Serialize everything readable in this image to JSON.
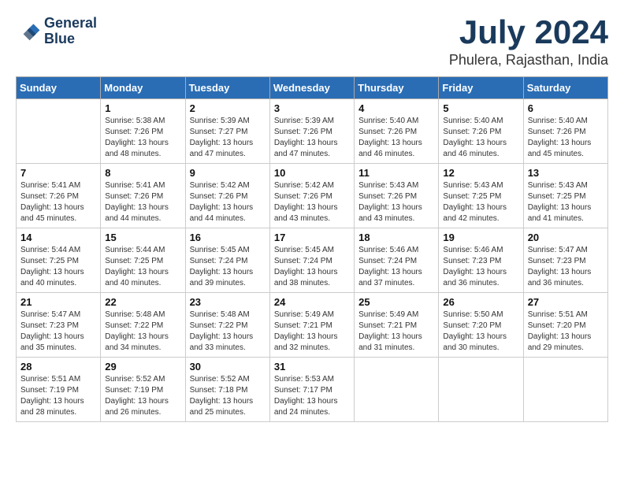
{
  "header": {
    "logo_line1": "General",
    "logo_line2": "Blue",
    "month_year": "July 2024",
    "location": "Phulera, Rajasthan, India"
  },
  "weekdays": [
    "Sunday",
    "Monday",
    "Tuesday",
    "Wednesday",
    "Thursday",
    "Friday",
    "Saturday"
  ],
  "weeks": [
    [
      {
        "day": "",
        "info": ""
      },
      {
        "day": "1",
        "info": "Sunrise: 5:38 AM\nSunset: 7:26 PM\nDaylight: 13 hours\nand 48 minutes."
      },
      {
        "day": "2",
        "info": "Sunrise: 5:39 AM\nSunset: 7:27 PM\nDaylight: 13 hours\nand 47 minutes."
      },
      {
        "day": "3",
        "info": "Sunrise: 5:39 AM\nSunset: 7:26 PM\nDaylight: 13 hours\nand 47 minutes."
      },
      {
        "day": "4",
        "info": "Sunrise: 5:40 AM\nSunset: 7:26 PM\nDaylight: 13 hours\nand 46 minutes."
      },
      {
        "day": "5",
        "info": "Sunrise: 5:40 AM\nSunset: 7:26 PM\nDaylight: 13 hours\nand 46 minutes."
      },
      {
        "day": "6",
        "info": "Sunrise: 5:40 AM\nSunset: 7:26 PM\nDaylight: 13 hours\nand 45 minutes."
      }
    ],
    [
      {
        "day": "7",
        "info": "Sunrise: 5:41 AM\nSunset: 7:26 PM\nDaylight: 13 hours\nand 45 minutes."
      },
      {
        "day": "8",
        "info": "Sunrise: 5:41 AM\nSunset: 7:26 PM\nDaylight: 13 hours\nand 44 minutes."
      },
      {
        "day": "9",
        "info": "Sunrise: 5:42 AM\nSunset: 7:26 PM\nDaylight: 13 hours\nand 44 minutes."
      },
      {
        "day": "10",
        "info": "Sunrise: 5:42 AM\nSunset: 7:26 PM\nDaylight: 13 hours\nand 43 minutes."
      },
      {
        "day": "11",
        "info": "Sunrise: 5:43 AM\nSunset: 7:26 PM\nDaylight: 13 hours\nand 43 minutes."
      },
      {
        "day": "12",
        "info": "Sunrise: 5:43 AM\nSunset: 7:25 PM\nDaylight: 13 hours\nand 42 minutes."
      },
      {
        "day": "13",
        "info": "Sunrise: 5:43 AM\nSunset: 7:25 PM\nDaylight: 13 hours\nand 41 minutes."
      }
    ],
    [
      {
        "day": "14",
        "info": "Sunrise: 5:44 AM\nSunset: 7:25 PM\nDaylight: 13 hours\nand 40 minutes."
      },
      {
        "day": "15",
        "info": "Sunrise: 5:44 AM\nSunset: 7:25 PM\nDaylight: 13 hours\nand 40 minutes."
      },
      {
        "day": "16",
        "info": "Sunrise: 5:45 AM\nSunset: 7:24 PM\nDaylight: 13 hours\nand 39 minutes."
      },
      {
        "day": "17",
        "info": "Sunrise: 5:45 AM\nSunset: 7:24 PM\nDaylight: 13 hours\nand 38 minutes."
      },
      {
        "day": "18",
        "info": "Sunrise: 5:46 AM\nSunset: 7:24 PM\nDaylight: 13 hours\nand 37 minutes."
      },
      {
        "day": "19",
        "info": "Sunrise: 5:46 AM\nSunset: 7:23 PM\nDaylight: 13 hours\nand 36 minutes."
      },
      {
        "day": "20",
        "info": "Sunrise: 5:47 AM\nSunset: 7:23 PM\nDaylight: 13 hours\nand 36 minutes."
      }
    ],
    [
      {
        "day": "21",
        "info": "Sunrise: 5:47 AM\nSunset: 7:23 PM\nDaylight: 13 hours\nand 35 minutes."
      },
      {
        "day": "22",
        "info": "Sunrise: 5:48 AM\nSunset: 7:22 PM\nDaylight: 13 hours\nand 34 minutes."
      },
      {
        "day": "23",
        "info": "Sunrise: 5:48 AM\nSunset: 7:22 PM\nDaylight: 13 hours\nand 33 minutes."
      },
      {
        "day": "24",
        "info": "Sunrise: 5:49 AM\nSunset: 7:21 PM\nDaylight: 13 hours\nand 32 minutes."
      },
      {
        "day": "25",
        "info": "Sunrise: 5:49 AM\nSunset: 7:21 PM\nDaylight: 13 hours\nand 31 minutes."
      },
      {
        "day": "26",
        "info": "Sunrise: 5:50 AM\nSunset: 7:20 PM\nDaylight: 13 hours\nand 30 minutes."
      },
      {
        "day": "27",
        "info": "Sunrise: 5:51 AM\nSunset: 7:20 PM\nDaylight: 13 hours\nand 29 minutes."
      }
    ],
    [
      {
        "day": "28",
        "info": "Sunrise: 5:51 AM\nSunset: 7:19 PM\nDaylight: 13 hours\nand 28 minutes."
      },
      {
        "day": "29",
        "info": "Sunrise: 5:52 AM\nSunset: 7:19 PM\nDaylight: 13 hours\nand 26 minutes."
      },
      {
        "day": "30",
        "info": "Sunrise: 5:52 AM\nSunset: 7:18 PM\nDaylight: 13 hours\nand 25 minutes."
      },
      {
        "day": "31",
        "info": "Sunrise: 5:53 AM\nSunset: 7:17 PM\nDaylight: 13 hours\nand 24 minutes."
      },
      {
        "day": "",
        "info": ""
      },
      {
        "day": "",
        "info": ""
      },
      {
        "day": "",
        "info": ""
      }
    ]
  ]
}
